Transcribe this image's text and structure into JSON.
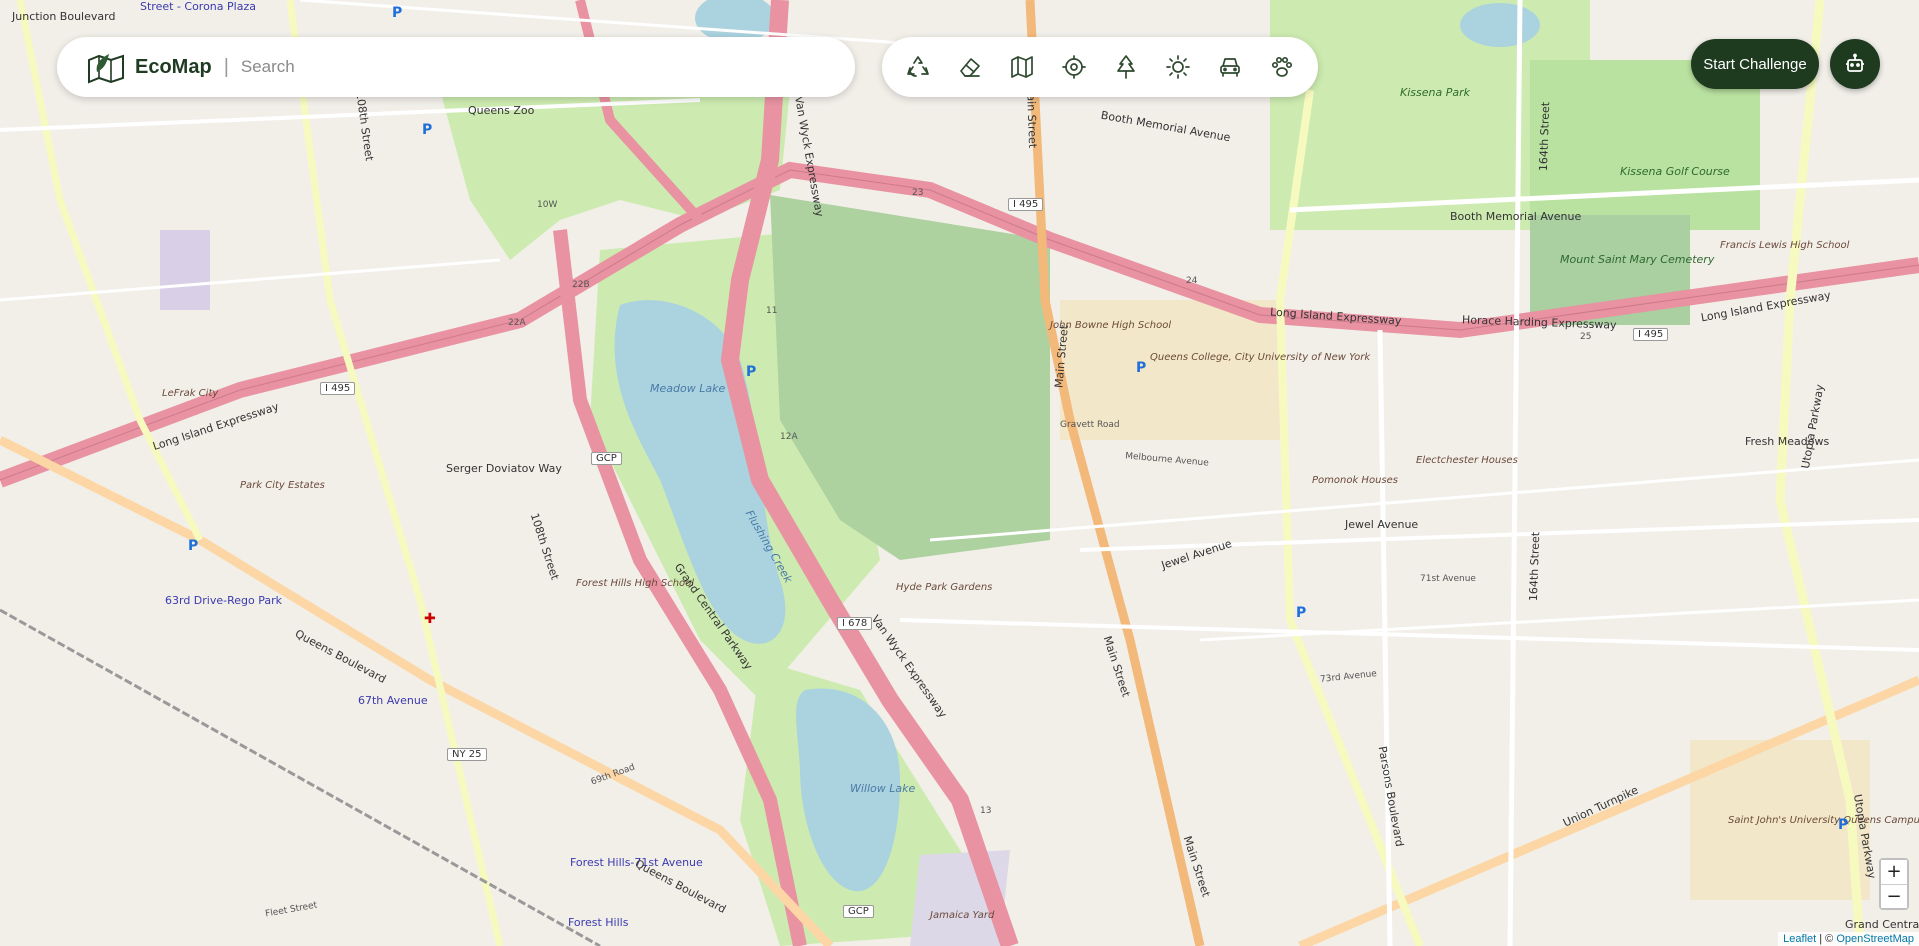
{
  "app": {
    "brand": "EcoMap",
    "separator": "|"
  },
  "search": {
    "placeholder": "Search",
    "value": ""
  },
  "toolbar": {
    "tools": [
      {
        "name": "recycling-icon"
      },
      {
        "name": "eraser-icon"
      },
      {
        "name": "map-icon"
      },
      {
        "name": "target-icon"
      },
      {
        "name": "tree-icon"
      },
      {
        "name": "sun-icon"
      },
      {
        "name": "car-icon"
      },
      {
        "name": "paw-icon"
      }
    ]
  },
  "actions": {
    "start_challenge": "Start Challenge",
    "robot": "robot-icon"
  },
  "zoom": {
    "in": "+",
    "out": "−"
  },
  "attribution": {
    "leaflet": "Leaflet",
    "sep": "|",
    "copy": "©",
    "osm": "OpenStreetMap"
  },
  "map": {
    "labels": {
      "queens_zoo": "Queens Zoo",
      "meadow_lake": "Meadow Lake",
      "willow_lake": "Willow Lake",
      "kissena_park": "Kissena Park",
      "kissena_golf": "Kissena Golf Course",
      "mount_saint_mary": "Mount Saint Mary Cemetery",
      "francis_lewis": "Francis Lewis High School",
      "queens_college": "Queens College, City University of New York",
      "john_bowne": "John Bowne High School",
      "pomonok": "Pomonok Houses",
      "electchester": "Electchester Houses",
      "hyde_park": "Hyde Park Gardens",
      "forest_hills_hs": "Forest Hills High School",
      "park_city": "Park City Estates",
      "lefrak": "LeFrak City",
      "serger": "Serger Doviatov Way",
      "st_johns": "Saint John's University Queens Campus",
      "fresh_meadows": "Fresh Meadows",
      "flushing_creek": "Flushing Creek",
      "jamaica_yard": "Jamaica Yard",
      "corona_plaza": "Street - Corona Plaza",
      "st_63rd": "63rd Drive-Rego Park",
      "st_67th": "67th Avenue",
      "st_forest_hills": "Forest Hills-71st Avenue",
      "st_forest": "Forest Hills",
      "junction": "Junction Boulevard",
      "lie_1": "Long Island Expressway",
      "lie_2": "Long Island Expressway",
      "lie_3": "Long Island Expressway",
      "horace": "Horace Harding Expressway",
      "van_wyck_1": "Van Wyck Expressway",
      "van_wyck_2": "Van Wyck Expressway",
      "gcp": "Grand Central Parkway",
      "main_1": "Main Street",
      "main_2": "Main Street",
      "main_3": "Main Street",
      "queens_blvd_1": "Queens Boulevard",
      "queens_blvd_2": "Queens Boulevard",
      "union_tpke": "Union Turnpike",
      "parsons": "Parsons Boulevard",
      "utopia_1": "Utopia Parkway",
      "utopia_2": "Utopia Parkway",
      "jewel_1": "Jewel Avenue",
      "jewel_2": "Jewel Avenue",
      "booth_1": "Booth Memorial Avenue",
      "booth_2": "Booth Memorial Avenue",
      "st_164": "164th Street",
      "st_164b": "164th Street",
      "st_108": "108th Street",
      "st_108b": "108th Street",
      "ave_73": "73rd Avenue",
      "ave_69": "69th Road",
      "ave_71": "71st Avenue",
      "gravett": "Gravett Road",
      "melbourne": "Melbourne Avenue",
      "fleet": "Fleet Street",
      "grand_central": "Grand Central",
      "i495_a": "I 495",
      "i495_b": "I 495",
      "i495_c": "I 495",
      "i678": "I 678",
      "gcp_a": "GCP",
      "gcp_b": "GCP",
      "ny25": "NY 25",
      "x22a": "22A",
      "x22b": "22B",
      "x23": "23",
      "x24": "24",
      "x25": "25",
      "x10w": "10W",
      "x11": "11",
      "x12a": "12A",
      "x13": "13"
    }
  }
}
